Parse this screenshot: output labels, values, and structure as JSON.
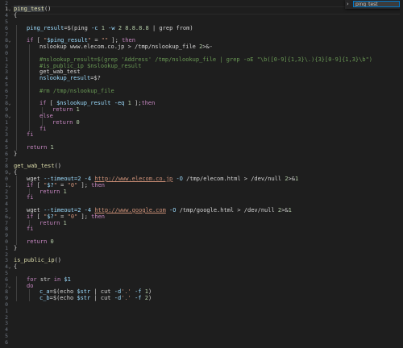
{
  "find": {
    "chevron": "›",
    "query": "ping_test"
  },
  "line_numbers": [
    "2",
    "3",
    "4",
    "5",
    "6",
    "7",
    "8",
    "9",
    "0",
    "1",
    "2",
    "3",
    "4",
    "5",
    "6",
    "7",
    "8",
    "9",
    "0",
    "1",
    "2",
    "3",
    "4",
    "5",
    "6",
    "7",
    "8",
    "9",
    "0",
    "1",
    "2",
    "3",
    "4",
    "5",
    "6",
    "7",
    "8",
    "9",
    "0",
    "1",
    "2",
    "3",
    "4",
    "5",
    "6",
    "7",
    "8",
    "9",
    "0",
    "1",
    "2",
    "3",
    "4",
    "5",
    "6"
  ],
  "active_line_number": "1",
  "code": {
    "l_ping_func": "ping_test()",
    "l_brace_open": "{",
    "l_ping_result": "ping_result=$(ping -c 1 -w 2 8.8.8.8 | grep from)",
    "l_if_ping": "if [ \"$ping_result\" = \"\" ]; then",
    "l_nslookup": "nslookup www.elecom.co.jp > /tmp/nslookup_file 2>&-",
    "l_comment1": "#nslookup_result=$(grep 'Address' /tmp/nslookup_file | grep -oE \"\\b([0-9]{1,3}\\.){3}[0-9]{1,3}\\b\")",
    "l_comment2": "#is_public_ip $nslookup_result",
    "l_get_wab_call": "get_wab_test",
    "l_nslookup_result": "nslookup_result=$?",
    "l_comment_rm": "#rm /tmp/nslookup_file",
    "l_if_nslookup": "if [ $nslookup_result -eq 1 ];then",
    "l_return1a": "return 1",
    "l_else": "else",
    "l_return0a": "return 0",
    "l_fi1": "fi",
    "l_fi2": "fi",
    "l_return1b": "return 1",
    "l_brace_close1": "}",
    "l_get_wab_func": "get_wab_test()",
    "l_brace_open2": "{",
    "l_wget1": "wget --timeout=2 -4 http://www.elecom.co.jp -O /tmp/elecom.html > /dev/null 2>&1",
    "l_if2": "if [ \"$?\" = \"0\" ]; then",
    "l_return1c": "return 1",
    "l_fi3": "fi",
    "l_wget2": "wget --timeout=2 -4 http://www.google.com -O /tmp/google.html > /dev/null 2>&1",
    "l_if3": "if [ \"$?\" = \"0\" ]; then",
    "l_return1d": "return 1",
    "l_fi4": "fi",
    "l_return0b": "return 0",
    "l_brace_close2": "}",
    "l_is_public_func": "is_public_ip()",
    "l_brace_open3": "{",
    "l_for": "for str in $1",
    "l_do": "do",
    "l_ca": "c_a=$(echo $str | cut -d'.' -f 1)",
    "l_cb": "c_b=$(echo $str | cut -d'.' -f 2)"
  }
}
